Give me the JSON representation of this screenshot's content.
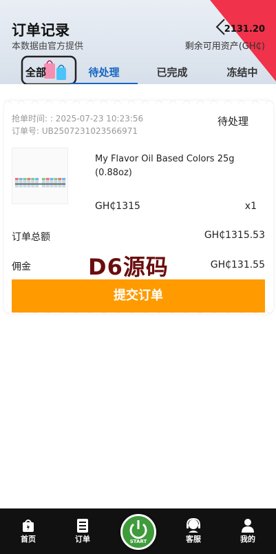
{
  "header": {
    "title": "订单记录",
    "subtitle": "本数据由官方提供",
    "balance": "2131.20",
    "balance_label": "剩余可用资产(GH₵)"
  },
  "tabs": [
    {
      "label": "全部",
      "active": false
    },
    {
      "label": "待处理",
      "active": true
    },
    {
      "label": "已完成",
      "active": false
    },
    {
      "label": "冻结中",
      "active": false
    }
  ],
  "order": {
    "time_text": "抢单时间: : 2025-07-23 10:23:56",
    "number_text": "订单号: UB2507231023566971",
    "status": "待处理",
    "product_name": "My Flavor Oil Based Colors 25g (0.88oz)",
    "price": "GH₵1315",
    "quantity": "x1",
    "total_label": "订单总额",
    "total_value": "GH₵1315.53",
    "commission_label": "佣金",
    "commission_value": "GH₵131.55",
    "submit_label": "提交订单"
  },
  "watermark": "D6源码",
  "bottom_nav": {
    "items": [
      {
        "label": "首页",
        "icon": "home-icon"
      },
      {
        "label": "订单",
        "icon": "orders-icon"
      },
      {
        "label": "客服",
        "icon": "support-icon"
      },
      {
        "label": "我的",
        "icon": "profile-icon"
      }
    ],
    "start_label": "START"
  },
  "colors": {
    "accent": "#1565c0",
    "button": "#ff9a00",
    "ribbon": "#f0324a",
    "nav_bg": "#111111",
    "start": "#3f9b3b"
  }
}
